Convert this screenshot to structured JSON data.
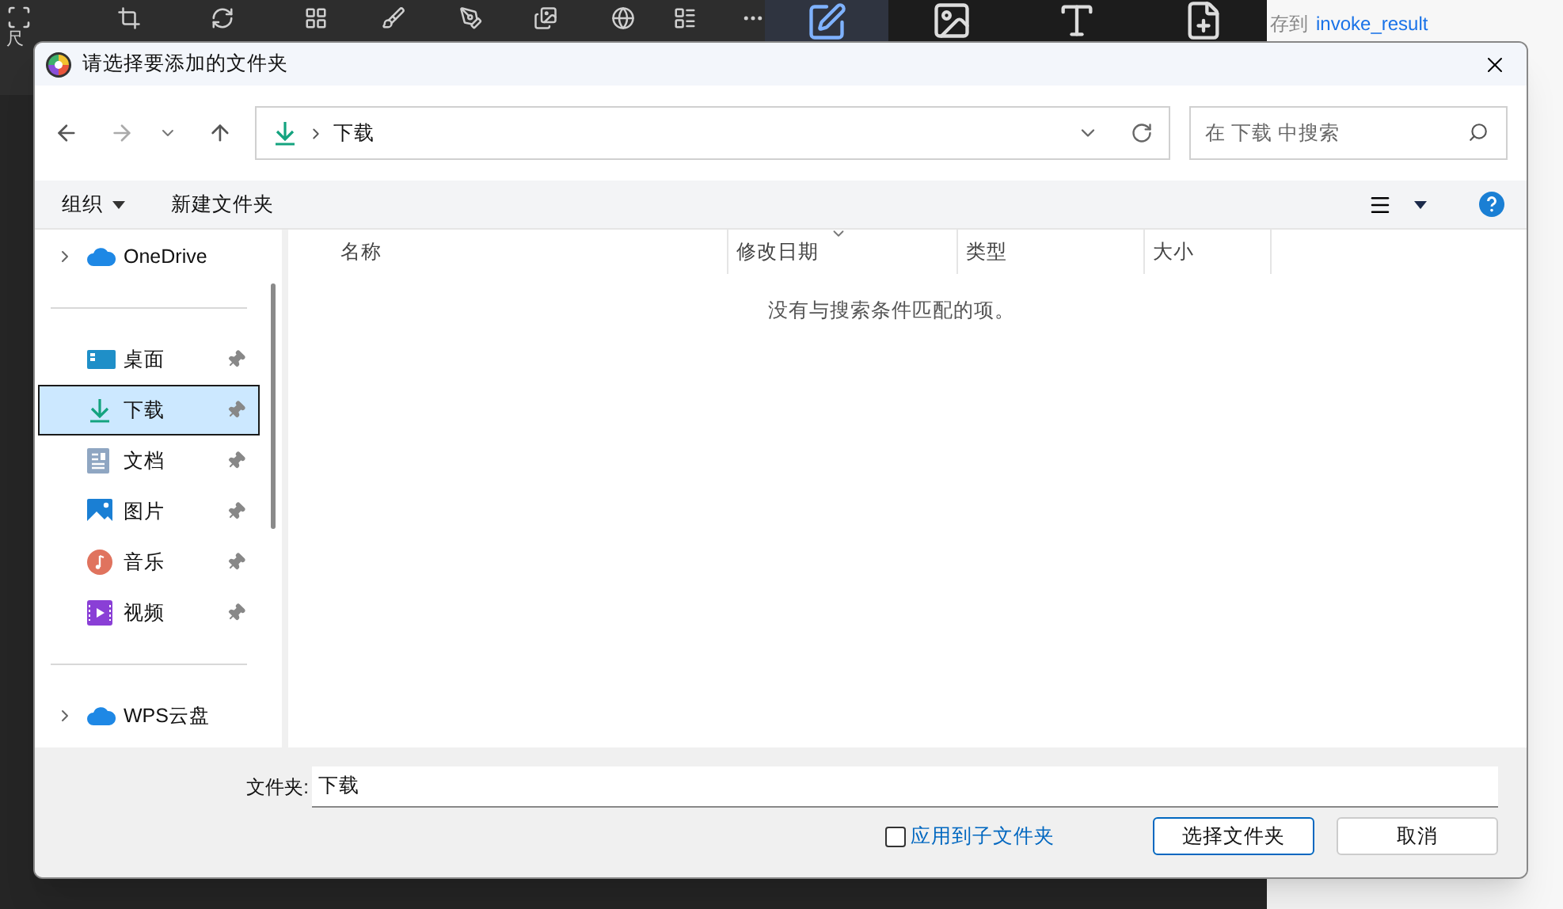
{
  "background_app": {
    "toolbar_fragment": "尺",
    "save_label": "存到",
    "save_link": "invoke_result"
  },
  "dialog": {
    "title": "请选择要添加的文件夹",
    "address": {
      "crumbs": [
        "下载"
      ]
    },
    "search": {
      "placeholder": "在 下载 中搜索"
    },
    "commands": [
      "组织",
      "新建文件夹"
    ],
    "sidebar": {
      "top": [
        {
          "label": "OneDrive",
          "kind": "cloud"
        }
      ],
      "quick_access": [
        {
          "label": "桌面",
          "kind": "desktop",
          "selected": false
        },
        {
          "label": "下载",
          "kind": "download",
          "selected": true
        },
        {
          "label": "文档",
          "kind": "document",
          "selected": false
        },
        {
          "label": "图片",
          "kind": "pictures",
          "selected": false
        },
        {
          "label": "音乐",
          "kind": "music",
          "selected": false
        },
        {
          "label": "视频",
          "kind": "video",
          "selected": false
        }
      ],
      "bottom": [
        {
          "label": "WPS云盘",
          "kind": "cloud"
        }
      ]
    },
    "columns": [
      {
        "label": "名称",
        "sorted": false
      },
      {
        "label": "修改日期",
        "sorted": true
      },
      {
        "label": "类型",
        "sorted": false
      },
      {
        "label": "大小",
        "sorted": false
      }
    ],
    "empty_message": "没有与搜索条件匹配的项。",
    "folder_label": "文件夹:",
    "folder_value": "下载",
    "apply_subfolders": {
      "label": "应用到子文件夹",
      "checked": false
    },
    "buttons": [
      {
        "label": "选择文件夹",
        "default": true
      },
      {
        "label": "取消",
        "default": false
      }
    ]
  }
}
